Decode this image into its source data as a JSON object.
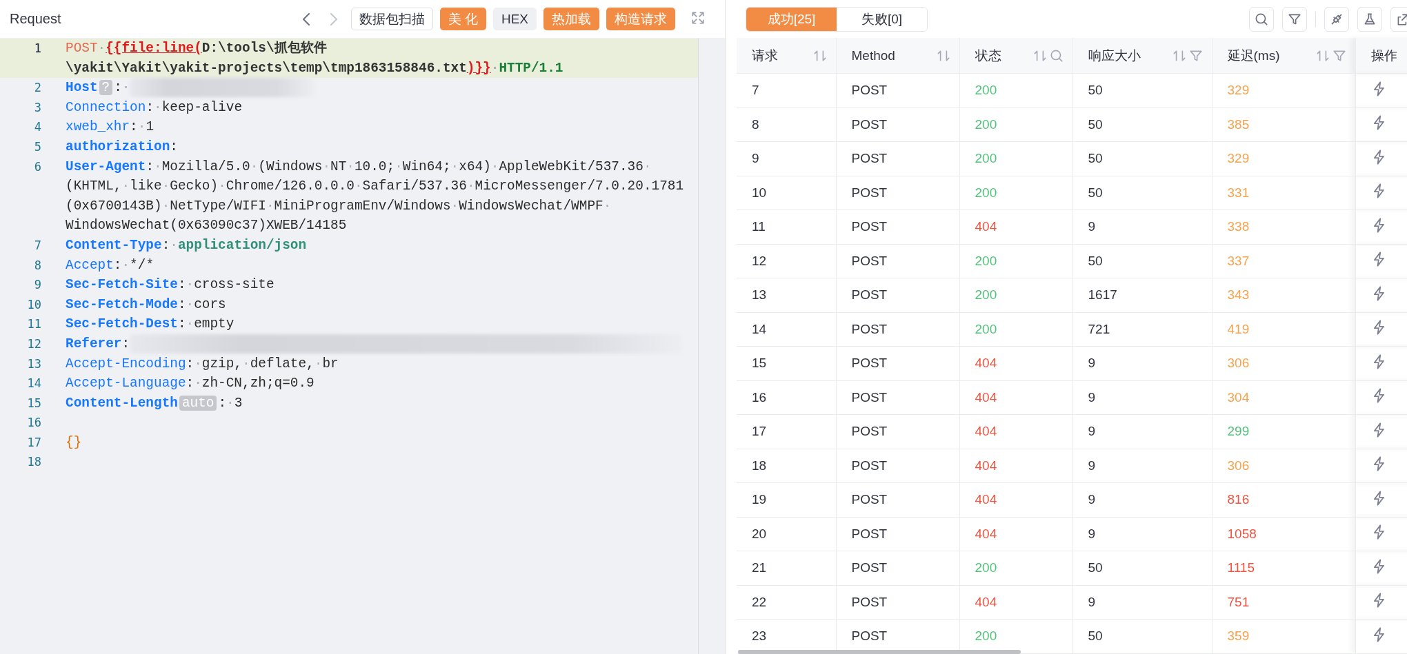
{
  "request_panel": {
    "title": "Request",
    "toolbar": {
      "back": {
        "disabled": false
      },
      "forward": {
        "disabled": true
      },
      "buttons": [
        {
          "label": "数据包扫描",
          "kind": "outline"
        },
        {
          "label": "美 化",
          "kind": "primary"
        },
        {
          "label": "HEX",
          "kind": "plain"
        },
        {
          "label": "热加载",
          "kind": "primary"
        },
        {
          "label": "构造请求",
          "kind": "primary"
        }
      ]
    },
    "editor": {
      "lines": [
        {
          "number": "1",
          "current": true,
          "wrapped": [
            {
              "segments": [
                {
                  "kind": "method",
                  "text": "POST·"
                },
                {
                  "kind": "template",
                  "text": "{{file:line("
                },
                {
                  "kind": "path",
                  "text": "D:\\tools\\抓包软件"
                }
              ]
            },
            {
              "segments": [
                {
                  "kind": "path",
                  "text": "\\yakit\\Yakit\\yakit-projects\\temp\\tmp1863158846.txt"
                },
                {
                  "kind": "template",
                  "text": ")}}"
                },
                {
                  "kind": "proto",
                  "text": "·HTTP/1.1"
                }
              ]
            }
          ]
        },
        {
          "number": "2",
          "current": false,
          "wrapped": [
            {
              "segments": [
                {
                  "kind": "key-bold",
                  "text": "Host"
                },
                {
                  "kind": "badge",
                  "text": "?"
                },
                {
                  "kind": "punct",
                  "text": ":·"
                },
                {
                  "kind": "redacted"
                }
              ]
            }
          ]
        },
        {
          "number": "3",
          "current": false,
          "wrapped": [
            {
              "segments": [
                {
                  "kind": "key",
                  "text": "Connection"
                },
                {
                  "kind": "punct",
                  "text": ":"
                },
                {
                  "kind": "value",
                  "text": "·keep-alive"
                }
              ]
            }
          ]
        },
        {
          "number": "4",
          "current": false,
          "wrapped": [
            {
              "segments": [
                {
                  "kind": "key",
                  "text": "xweb_xhr"
                },
                {
                  "kind": "punct",
                  "text": ":"
                },
                {
                  "kind": "value",
                  "text": "·1"
                }
              ]
            }
          ]
        },
        {
          "number": "5",
          "current": false,
          "wrapped": [
            {
              "segments": [
                {
                  "kind": "key-bold",
                  "text": "authorization"
                },
                {
                  "kind": "punct",
                  "text": ":"
                }
              ]
            }
          ]
        },
        {
          "number": "6",
          "current": false,
          "wrapped": [
            {
              "segments": [
                {
                  "kind": "key-bold",
                  "text": "User-Agent"
                },
                {
                  "kind": "punct",
                  "text": ":"
                },
                {
                  "kind": "value",
                  "text": "·Mozilla/5.0·(Windows·NT·10.0;·Win64;·x64)·AppleWebKit/537.36·"
                }
              ]
            },
            {
              "segments": [
                {
                  "kind": "value",
                  "text": "(KHTML,·like·Gecko)·Chrome/126.0.0.0·Safari/537.36·MicroMessenger/7.0.20.1781"
                }
              ]
            },
            {
              "segments": [
                {
                  "kind": "value",
                  "text": "(0x6700143B)·NetType/WIFI·MiniProgramEnv/Windows·WindowsWechat/WMPF·"
                }
              ]
            },
            {
              "segments": [
                {
                  "kind": "value",
                  "text": "WindowsWechat(0x63090c37)XWEB/14185"
                }
              ]
            }
          ]
        },
        {
          "number": "7",
          "current": false,
          "wrapped": [
            {
              "segments": [
                {
                  "kind": "key-bold",
                  "text": "Content-Type"
                },
                {
                  "kind": "punct",
                  "text": ":"
                },
                {
                  "kind": "value",
                  "text": "·"
                },
                {
                  "kind": "json",
                  "text": "application/json"
                }
              ]
            }
          ]
        },
        {
          "number": "8",
          "current": false,
          "wrapped": [
            {
              "segments": [
                {
                  "kind": "key",
                  "text": "Accept"
                },
                {
                  "kind": "punct",
                  "text": ":"
                },
                {
                  "kind": "value",
                  "text": "·*/*"
                }
              ]
            }
          ]
        },
        {
          "number": "9",
          "current": false,
          "wrapped": [
            {
              "segments": [
                {
                  "kind": "key-bold",
                  "text": "Sec-Fetch-Site"
                },
                {
                  "kind": "punct",
                  "text": ":"
                },
                {
                  "kind": "value",
                  "text": "·cross-site"
                }
              ]
            }
          ]
        },
        {
          "number": "10",
          "current": false,
          "wrapped": [
            {
              "segments": [
                {
                  "kind": "key-bold",
                  "text": "Sec-Fetch-Mode"
                },
                {
                  "kind": "punct",
                  "text": ":"
                },
                {
                  "kind": "value",
                  "text": "·cors"
                }
              ]
            }
          ]
        },
        {
          "number": "11",
          "current": false,
          "wrapped": [
            {
              "segments": [
                {
                  "kind": "key-bold",
                  "text": "Sec-Fetch-Dest"
                },
                {
                  "kind": "punct",
                  "text": ":"
                },
                {
                  "kind": "value",
                  "text": "·empty"
                }
              ]
            }
          ]
        },
        {
          "number": "12",
          "current": false,
          "wrapped": [
            {
              "segments": [
                {
                  "kind": "key-bold",
                  "text": "Referer"
                },
                {
                  "kind": "punct",
                  "text": ":"
                },
                {
                  "kind": "redacted"
                }
              ]
            }
          ]
        },
        {
          "number": "13",
          "current": false,
          "wrapped": [
            {
              "segments": [
                {
                  "kind": "key",
                  "text": "Accept-Encoding"
                },
                {
                  "kind": "punct",
                  "text": ":"
                },
                {
                  "kind": "value",
                  "text": "·gzip,·deflate,·br"
                }
              ]
            }
          ]
        },
        {
          "number": "14",
          "current": false,
          "wrapped": [
            {
              "segments": [
                {
                  "kind": "key",
                  "text": "Accept-Language"
                },
                {
                  "kind": "punct",
                  "text": ":"
                },
                {
                  "kind": "value",
                  "text": "·zh-CN,zh;q=0.9"
                }
              ]
            }
          ]
        },
        {
          "number": "15",
          "current": false,
          "wrapped": [
            {
              "segments": [
                {
                  "kind": "key-bold",
                  "text": "Content-Length"
                },
                {
                  "kind": "badge",
                  "text": "auto"
                },
                {
                  "kind": "punct",
                  "text": ":"
                },
                {
                  "kind": "value",
                  "text": "·3"
                }
              ]
            }
          ]
        },
        {
          "number": "16",
          "current": false
        },
        {
          "number": "17",
          "current": false,
          "wrapped": [
            {
              "segments": [
                {
                  "kind": "brace",
                  "text": "{}"
                }
              ]
            }
          ]
        },
        {
          "number": "18",
          "current": false
        }
      ]
    }
  },
  "results_panel": {
    "tabs": [
      {
        "label": "成功[25]",
        "selected": true
      },
      {
        "label": "失败[0]",
        "selected": false
      }
    ],
    "table": {
      "columns": [
        {
          "label": "请求",
          "sortable": true,
          "searchable": false,
          "filterable": false
        },
        {
          "label": "Method",
          "sortable": true,
          "searchable": false,
          "filterable": false
        },
        {
          "label": "状态",
          "sortable": true,
          "searchable": true,
          "filterable": false
        },
        {
          "label": "响应大小",
          "sortable": true,
          "searchable": false,
          "filterable": true
        },
        {
          "label": "延迟(ms)",
          "sortable": true,
          "searchable": false,
          "filterable": true
        },
        {
          "label": "操作",
          "sortable": false,
          "searchable": false,
          "filterable": false
        }
      ],
      "rows": [
        {
          "request": "7",
          "method": "POST",
          "status": {
            "text": "200",
            "color": "#52c27a"
          },
          "size": "50",
          "latency": {
            "text": "329",
            "color": "#f7a34c"
          }
        },
        {
          "request": "8",
          "method": "POST",
          "status": {
            "text": "200",
            "color": "#52c27a"
          },
          "size": "50",
          "latency": {
            "text": "385",
            "color": "#f7a34c"
          }
        },
        {
          "request": "9",
          "method": "POST",
          "status": {
            "text": "200",
            "color": "#52c27a"
          },
          "size": "50",
          "latency": {
            "text": "329",
            "color": "#f7a34c"
          }
        },
        {
          "request": "10",
          "method": "POST",
          "status": {
            "text": "200",
            "color": "#52c27a"
          },
          "size": "50",
          "latency": {
            "text": "331",
            "color": "#f7a34c"
          }
        },
        {
          "request": "11",
          "method": "POST",
          "status": {
            "text": "404",
            "color": "#f0533f"
          },
          "size": "9",
          "latency": {
            "text": "338",
            "color": "#f7a34c"
          }
        },
        {
          "request": "12",
          "method": "POST",
          "status": {
            "text": "200",
            "color": "#52c27a"
          },
          "size": "50",
          "latency": {
            "text": "337",
            "color": "#f7a34c"
          }
        },
        {
          "request": "13",
          "method": "POST",
          "status": {
            "text": "200",
            "color": "#52c27a"
          },
          "size": "1617",
          "latency": {
            "text": "343",
            "color": "#f7a34c"
          }
        },
        {
          "request": "14",
          "method": "POST",
          "status": {
            "text": "200",
            "color": "#52c27a"
          },
          "size": "721",
          "latency": {
            "text": "419",
            "color": "#f7a34c"
          }
        },
        {
          "request": "15",
          "method": "POST",
          "status": {
            "text": "404",
            "color": "#f0533f"
          },
          "size": "9",
          "latency": {
            "text": "306",
            "color": "#f7a34c"
          }
        },
        {
          "request": "16",
          "method": "POST",
          "status": {
            "text": "404",
            "color": "#f0533f"
          },
          "size": "9",
          "latency": {
            "text": "304",
            "color": "#f7a34c"
          }
        },
        {
          "request": "17",
          "method": "POST",
          "status": {
            "text": "404",
            "color": "#f0533f"
          },
          "size": "9",
          "latency": {
            "text": "299",
            "color": "#52c27a"
          }
        },
        {
          "request": "18",
          "method": "POST",
          "status": {
            "text": "404",
            "color": "#f0533f"
          },
          "size": "9",
          "latency": {
            "text": "306",
            "color": "#f7a34c"
          }
        },
        {
          "request": "19",
          "method": "POST",
          "status": {
            "text": "404",
            "color": "#f0533f"
          },
          "size": "9",
          "latency": {
            "text": "816",
            "color": "#f0533f"
          }
        },
        {
          "request": "20",
          "method": "POST",
          "status": {
            "text": "404",
            "color": "#f0533f"
          },
          "size": "9",
          "latency": {
            "text": "1058",
            "color": "#f0533f"
          }
        },
        {
          "request": "21",
          "method": "POST",
          "status": {
            "text": "200",
            "color": "#52c27a"
          },
          "size": "50",
          "latency": {
            "text": "1115",
            "color": "#f0533f"
          }
        },
        {
          "request": "22",
          "method": "POST",
          "status": {
            "text": "404",
            "color": "#f0533f"
          },
          "size": "9",
          "latency": {
            "text": "751",
            "color": "#f0533f"
          }
        },
        {
          "request": "23",
          "method": "POST",
          "status": {
            "text": "200",
            "color": "#52c27a"
          },
          "size": "50",
          "latency": {
            "text": "359",
            "color": "#f7a34c"
          }
        }
      ]
    }
  }
}
